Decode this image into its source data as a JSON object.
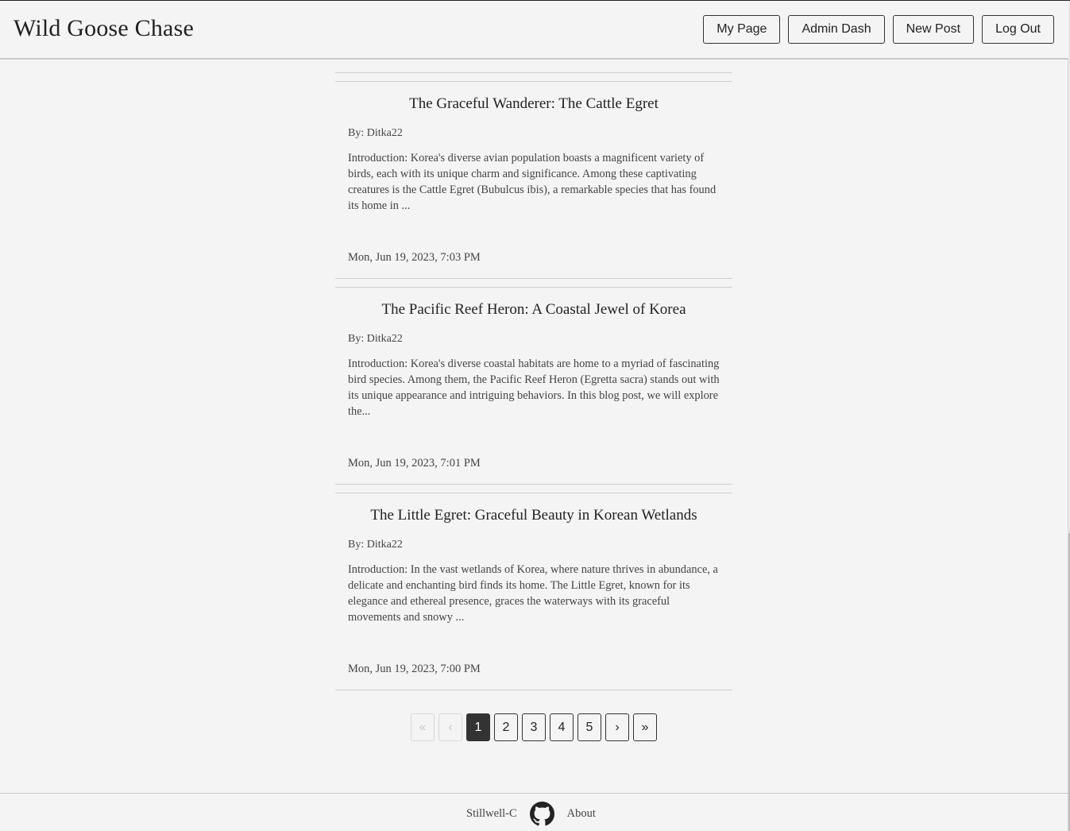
{
  "header": {
    "brand": "Wild Goose Chase",
    "nav": {
      "my_page": "My Page",
      "admin_dash": "Admin Dash",
      "new_post": "New Post",
      "log_out": "Log Out"
    }
  },
  "posts": [
    {
      "title": "The Graceful Wanderer: The Cattle Egret",
      "author": "By: Ditka22",
      "excerpt": "Introduction: Korea's diverse avian population boasts a magnificent variety of birds, each with its unique charm and significance. Among these captivating creatures is the Cattle Egret (Bubulcus ibis), a remarkable species that has found its home in ...",
      "date": "Mon, Jun 19, 2023, 7:03 PM"
    },
    {
      "title": "The Pacific Reef Heron: A Coastal Jewel of Korea",
      "author": "By: Ditka22",
      "excerpt": "Introduction: Korea's diverse coastal habitats are home to a myriad of fascinating bird species. Among them, the Pacific Reef Heron (Egretta sacra) stands out with its unique appearance and intriguing behaviors. In this blog post, we will explore the...",
      "date": "Mon, Jun 19, 2023, 7:01 PM"
    },
    {
      "title": "The Little Egret: Graceful Beauty in Korean Wetlands",
      "author": "By: Ditka22",
      "excerpt": "Introduction: In the vast wetlands of Korea, where nature thrives in abundance, a delicate and enchanting bird finds its home. The Little Egret, known for its elegance and ethereal presence, graces the waterways with its graceful movements and snowy ...",
      "date": "Mon, Jun 19, 2023, 7:00 PM"
    }
  ],
  "pagination": {
    "first": "«",
    "prev": "‹",
    "pages": [
      "1",
      "2",
      "3",
      "4",
      "5"
    ],
    "current": "1",
    "next": "›",
    "last": "»"
  },
  "footer": {
    "github_user": "Stillwell-C",
    "github_icon": "github-icon",
    "about": "About"
  }
}
